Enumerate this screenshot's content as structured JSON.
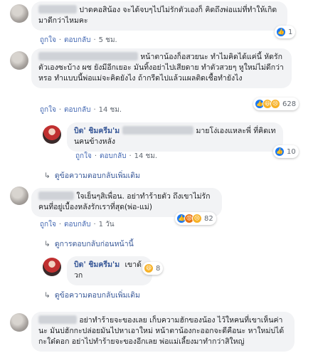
{
  "comments": [
    {
      "text": "ปาดคอสิน้อง จะได้จบๆไปไม่รักตัวเองก็ คิดถึงพ่อแม่ที่ทำให้เกิดมาดีกว่าไหมคะ",
      "like": "ถูกใจ",
      "reply": "ตอบกลับ",
      "time": "5 ชม.",
      "reaction_count": "1"
    },
    {
      "text": "หน้าตาน้องก็อสวยนะ ทำไมคิดได้แค่นี้ หัดรักตัวเองซะบ้าง ผช ยังมีอีกเยอะ มันทิ้งอย่าไปเสียดาย ทำตัวสวยๆ หูใหม่ไม่ดีกว่าหรอ ทำแบบนี้พ่อแม่จะคิดยังไง ถ้ากรีดไปแล้วแผลติดเชื้อทำยังไง",
      "like": "ถูกใจ",
      "reply": "ตอบกลับ",
      "time": "14 ชม.",
      "reaction_count": "628",
      "reply_item": {
        "name": "บิด' ชิมครีม'ม",
        "text": "มายโง่เองแหละพี่ ที่คิดเทนคนข้างหลัง",
        "like": "ถูกใจ",
        "reply": "ตอบกลับ",
        "time": "14 ชม.",
        "reaction_count": "10"
      },
      "more_replies": "ดูข้อความตอบกลับเพิ่มเติม"
    },
    {
      "text": "ใจเย็นๆสิเพื่อน. อย่าทำร้ายตัว ถึงเขาไม่รัก คนที่อยู่เบื้องหลังรักเราที่สุด(พ่อ-แม่)",
      "like": "ถูกใจ",
      "reply": "ตอบกลับ",
      "time": "1 วัน",
      "reaction_count": "82",
      "previous_replies": "ดูการตอบกลับก่อนหน้านี้",
      "reply_item": {
        "name": "บิด' ชิมครีม'ม",
        "text": "เขาด้วก",
        "reaction_count": "8"
      },
      "more_replies": "ดูข้อความตอบกลับเพิ่มเติม"
    },
    {
      "text": "อย่าทำร้ายจะของเลย เก็บความฮักของน้อง ไว้ใหคนที่เขาเห็นค่านะ มันบ่ฮักกะปล่อยมันไปหาเอาใหม่ หน้าตาน้องกะออกจะดีคือนะ หาใหม่บ่ได้กะใด๋ดอก อย่าไปทำร้ายจะของอีกเลย พ่อแม่เลี้ยงมาทำกว่าสิใหญ่"
    }
  ],
  "icons": {
    "like": "like-icon",
    "haha": "haha-icon",
    "sad": "sad-icon",
    "angry": "angry-icon",
    "reply_arrow": "reply-arrow-icon"
  },
  "colors": {
    "link": "#385898",
    "bubble": "#f2f3f5",
    "like_blue": "#1877f2"
  }
}
